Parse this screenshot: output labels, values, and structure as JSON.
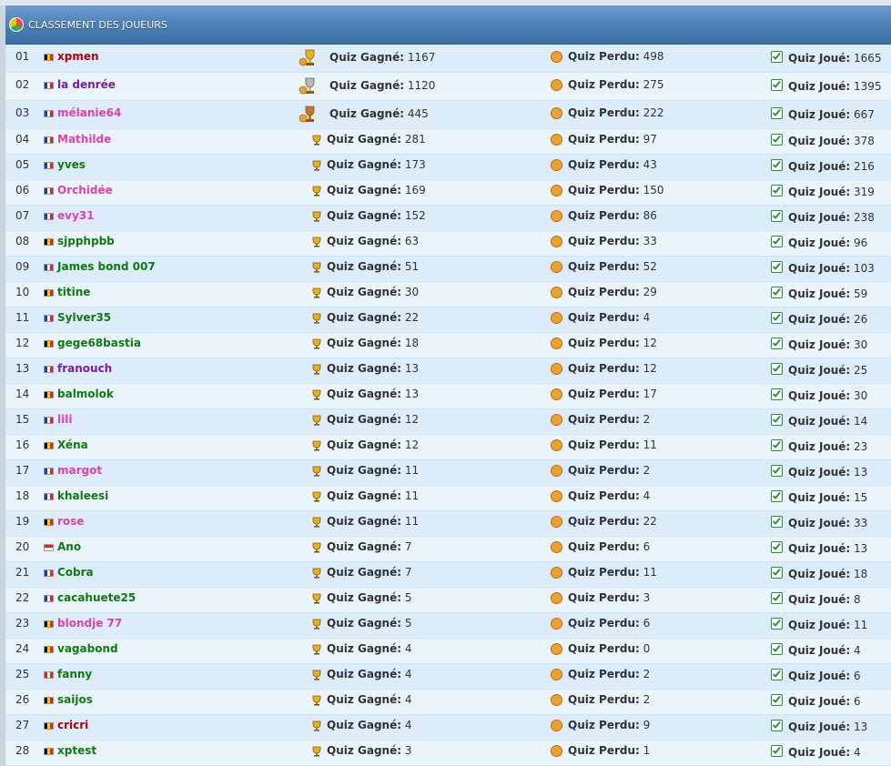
{
  "title": "CLASSEMENT DES JOUEURS",
  "labels": {
    "won": "Quiz Gagné:",
    "lost": "Quiz Perdu:",
    "played": "Quiz Joué:"
  },
  "colors": {
    "header": "#4f82b8",
    "row_odd": "#dcecf8",
    "row_even": "#eaf4fb",
    "name_red": "#b3000c",
    "name_purple": "#7a1ca8",
    "name_pink": "#e040a8",
    "name_green": "#107a10"
  },
  "players": [
    {
      "rank": "01",
      "flag": "be",
      "name": "xpmen",
      "color": "red",
      "won": "1167",
      "lost": "498",
      "played": "1665",
      "trophy": "gold"
    },
    {
      "rank": "02",
      "flag": "fr",
      "name": "la denrée",
      "color": "purple",
      "won": "1120",
      "lost": "275",
      "played": "1395",
      "trophy": "silver"
    },
    {
      "rank": "03",
      "flag": "fr",
      "name": "mélanie64",
      "color": "pink",
      "won": "445",
      "lost": "222",
      "played": "667",
      "trophy": "bronze"
    },
    {
      "rank": "04",
      "flag": "fr",
      "name": "Mathilde",
      "color": "pink",
      "won": "281",
      "lost": "97",
      "played": "378"
    },
    {
      "rank": "05",
      "flag": "fr",
      "name": "yves",
      "color": "green",
      "won": "173",
      "lost": "43",
      "played": "216"
    },
    {
      "rank": "06",
      "flag": "fr",
      "name": "Orchidée",
      "color": "pink",
      "won": "169",
      "lost": "150",
      "played": "319"
    },
    {
      "rank": "07",
      "flag": "fr",
      "name": "evy31",
      "color": "pink",
      "won": "152",
      "lost": "86",
      "played": "238"
    },
    {
      "rank": "08",
      "flag": "be",
      "name": "sjpphpbb",
      "color": "green",
      "won": "63",
      "lost": "33",
      "played": "96"
    },
    {
      "rank": "09",
      "flag": "fr",
      "name": "James bond 007",
      "color": "green",
      "won": "51",
      "lost": "52",
      "played": "103"
    },
    {
      "rank": "10",
      "flag": "be",
      "name": "titine",
      "color": "green",
      "won": "30",
      "lost": "29",
      "played": "59"
    },
    {
      "rank": "11",
      "flag": "fr",
      "name": "Sylver35",
      "color": "green",
      "won": "22",
      "lost": "4",
      "played": "26"
    },
    {
      "rank": "12",
      "flag": "be",
      "name": "gege68bastia",
      "color": "green",
      "won": "18",
      "lost": "12",
      "played": "30"
    },
    {
      "rank": "13",
      "flag": "fr",
      "name": "franouch",
      "color": "purple",
      "won": "13",
      "lost": "12",
      "played": "25"
    },
    {
      "rank": "14",
      "flag": "be",
      "name": "balmolok",
      "color": "green",
      "won": "13",
      "lost": "17",
      "played": "30"
    },
    {
      "rank": "15",
      "flag": "fr",
      "name": "lili",
      "color": "pink",
      "won": "12",
      "lost": "2",
      "played": "14"
    },
    {
      "rank": "16",
      "flag": "be",
      "name": "Xéna",
      "color": "green",
      "won": "12",
      "lost": "11",
      "played": "23"
    },
    {
      "rank": "17",
      "flag": "fr",
      "name": "margot",
      "color": "pink",
      "won": "11",
      "lost": "2",
      "played": "13"
    },
    {
      "rank": "18",
      "flag": "fr",
      "name": "khaleesi",
      "color": "green",
      "won": "11",
      "lost": "4",
      "played": "15"
    },
    {
      "rank": "19",
      "flag": "be",
      "name": "rose",
      "color": "pink",
      "won": "11",
      "lost": "22",
      "played": "33"
    },
    {
      "rank": "20",
      "flag": "mc",
      "name": "Ano",
      "color": "green",
      "won": "7",
      "lost": "6",
      "played": "13"
    },
    {
      "rank": "21",
      "flag": "fr",
      "name": "Cobra",
      "color": "green",
      "won": "7",
      "lost": "11",
      "played": "18"
    },
    {
      "rank": "22",
      "flag": "fr",
      "name": "cacahuete25",
      "color": "green",
      "won": "5",
      "lost": "3",
      "played": "8"
    },
    {
      "rank": "23",
      "flag": "be",
      "name": "blondje 77",
      "color": "pink",
      "won": "5",
      "lost": "6",
      "played": "11"
    },
    {
      "rank": "24",
      "flag": "be",
      "name": "vagabond",
      "color": "green",
      "won": "4",
      "lost": "0",
      "played": "4"
    },
    {
      "rank": "25",
      "flag": "ca",
      "name": "fanny",
      "color": "green",
      "won": "4",
      "lost": "2",
      "played": "6"
    },
    {
      "rank": "26",
      "flag": "be",
      "name": "saijos",
      "color": "green",
      "won": "4",
      "lost": "2",
      "played": "6"
    },
    {
      "rank": "27",
      "flag": "be",
      "name": "cricri",
      "color": "red",
      "won": "4",
      "lost": "9",
      "played": "13"
    },
    {
      "rank": "28",
      "flag": "be",
      "name": "xptest",
      "color": "green",
      "won": "3",
      "lost": "1",
      "played": "4"
    }
  ]
}
